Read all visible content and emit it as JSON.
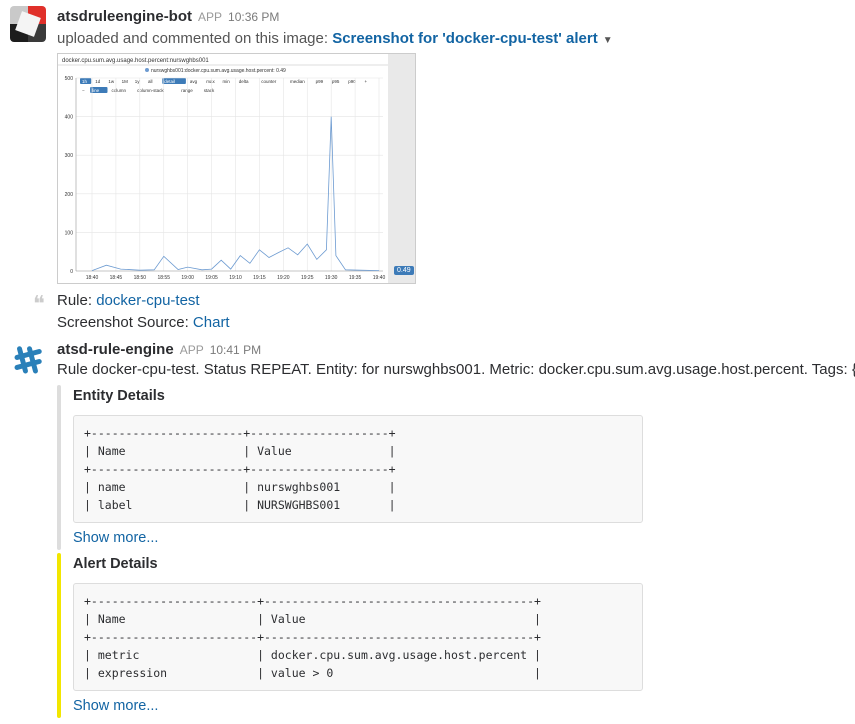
{
  "message1": {
    "username": "atsdruleengine-bot",
    "app_badge": "APP",
    "time": "10:36 PM",
    "action_text": "uploaded and commented on this image:",
    "file_title": "Screenshot for 'docker-cpu-test' alert",
    "rule_label": "Rule:",
    "rule_link": "docker-cpu-test",
    "source_label": "Screenshot Source:",
    "source_link": "Chart",
    "thumbnail": {
      "title": "docker.cpu.sum.avg.usage.host.percent:nurswghbs001",
      "legend": "nurswghbs001:docker.cpu.sum.avg.usage.host.percent: 0.49",
      "toolbar_row1": [
        "1h",
        "1d",
        "1w",
        "1M",
        "1y",
        "all",
        "detail",
        "avg",
        "max",
        "min",
        "delta",
        "counter",
        "median",
        "p99",
        "p95",
        "p90",
        "+"
      ],
      "toolbar_row2": [
        "−",
        "line",
        "column",
        "column-stack",
        "range",
        "stack"
      ],
      "value_badge": "0.49"
    },
    "chart_data": {
      "type": "line",
      "title": "docker.cpu.sum.avg.usage.host.percent:nurswghbs001",
      "series": [
        {
          "name": "nurswghbs001:docker.cpu.sum.avg.usage.host.percent",
          "color": "#6d9bd1"
        }
      ],
      "x_ticks": [
        "18:40",
        "18:45",
        "18:50",
        "18:55",
        "19:00",
        "19:05",
        "19:10",
        "19:15",
        "19:20",
        "19:25",
        "19:30",
        "19:35",
        "19:40"
      ],
      "y_ticks": [
        0,
        100,
        200,
        300,
        400,
        500
      ],
      "ylim": [
        0,
        500
      ],
      "x": [
        "18:40",
        "18:43",
        "18:46",
        "18:50",
        "18:53",
        "18:55",
        "18:58",
        "19:00",
        "19:03",
        "19:05",
        "19:07",
        "19:09",
        "19:11",
        "19:13",
        "19:15",
        "19:17",
        "19:19",
        "19:21",
        "19:23",
        "19:25",
        "19:27",
        "19:29",
        "19:30",
        "19:31",
        "19:33",
        "19:36",
        "19:40"
      ],
      "values": [
        1,
        15,
        5,
        2,
        3,
        38,
        4,
        10,
        3,
        5,
        28,
        5,
        40,
        20,
        55,
        35,
        48,
        60,
        42,
        70,
        30,
        55,
        400,
        40,
        3,
        2,
        1
      ],
      "grid": true
    }
  },
  "message2": {
    "username": "atsd-rule-engine",
    "app_badge": "APP",
    "time": "10:41 PM",
    "text": "Rule docker-cpu-test. Status REPEAT. Entity: for nurswghbs001. Metric: docker.cpu.sum.avg.usage.host.percent. Tags: {}",
    "entity": {
      "title": "Entity Details",
      "table": "+----------------------+--------------------+\n| Name                 | Value              |\n+----------------------+--------------------+\n| name                 | nurswghbs001       |\n| label                | NURSWGHBS001       |",
      "show_more": "Show more...",
      "bar_color": "#dddddd"
    },
    "alert": {
      "title": "Alert Details",
      "table": "+------------------------+---------------------------------------+\n| Name                   | Value                                 |\n+------------------------+---------------------------------------+\n| metric                 | docker.cpu.sum.avg.usage.host.percent |\n| expression             | value > 0                             |",
      "show_more": "Show more...",
      "bar_color": "#f2e600"
    }
  }
}
